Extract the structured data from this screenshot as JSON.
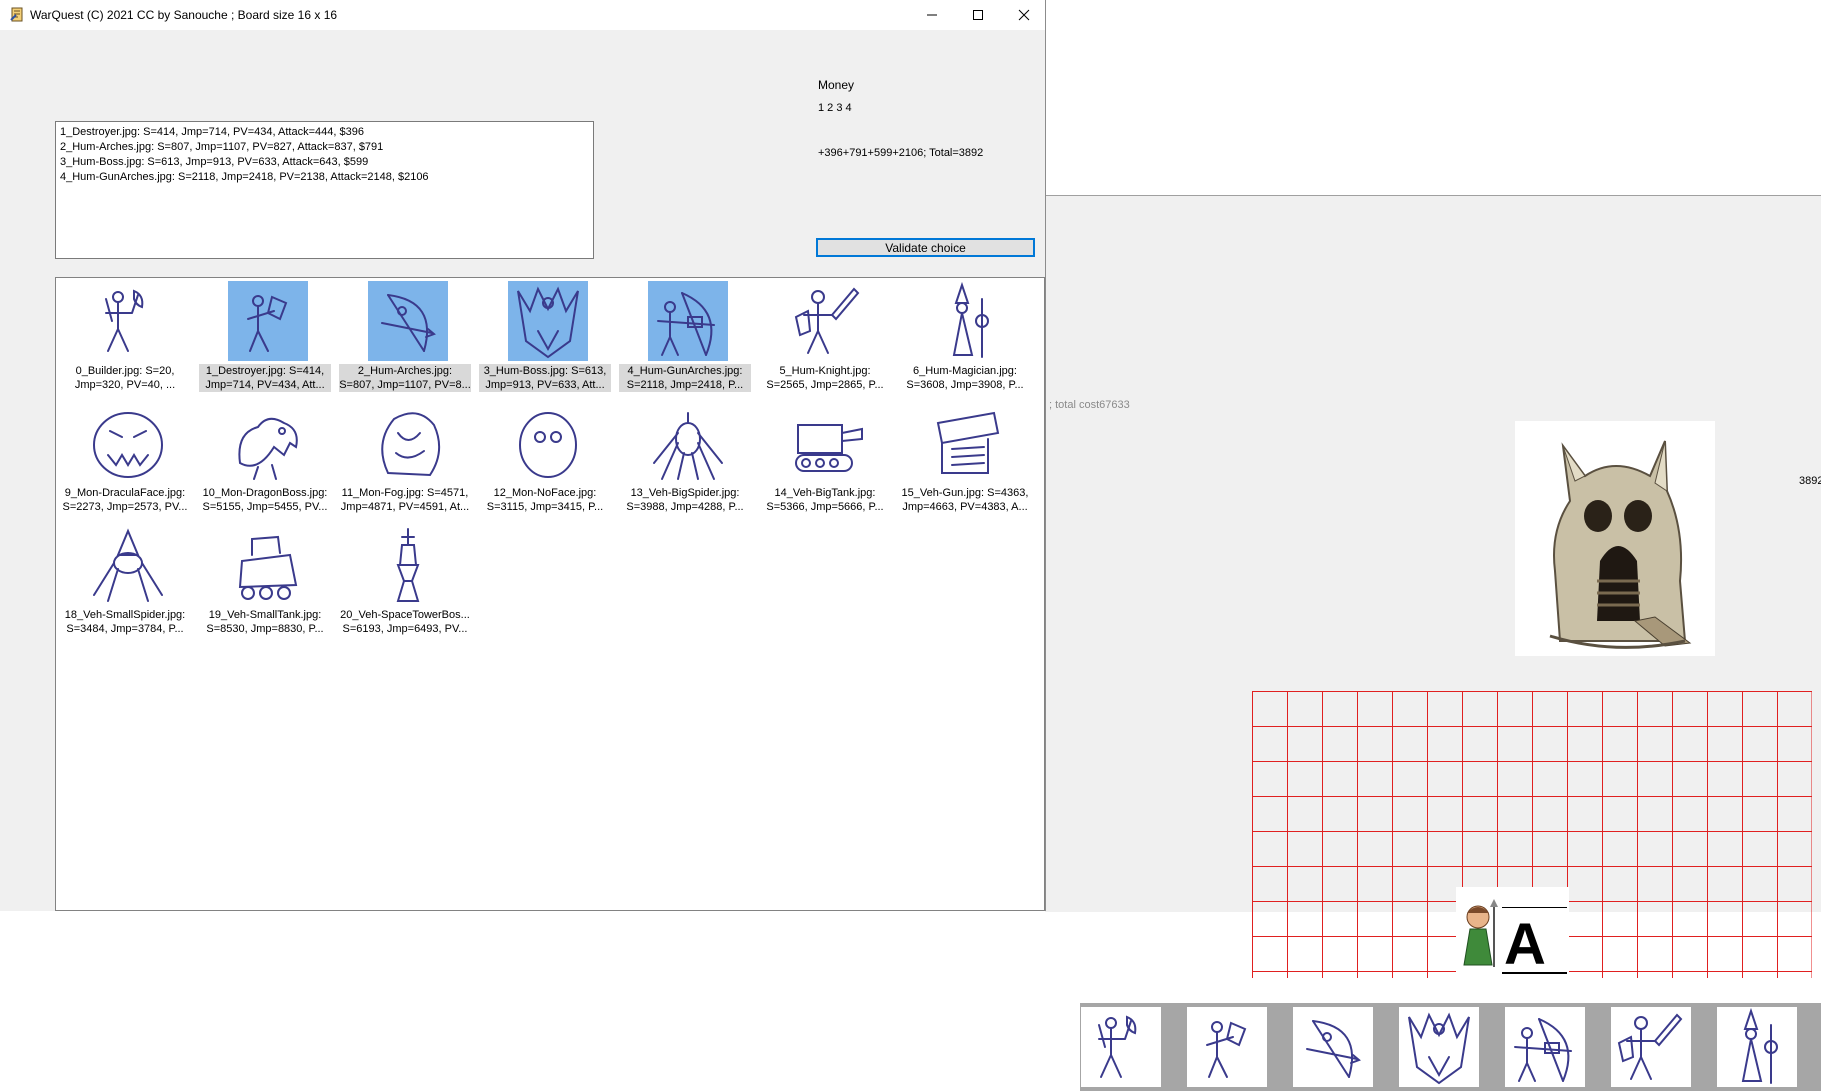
{
  "main_window": {
    "title": "WarQuest (C) 2021 CC by Sanouche  ; Board size 16 x 16",
    "money": {
      "label": "Money",
      "selected_numbers": "1 2 3 4",
      "total_text": "+396+791+599+2106; Total=3892"
    },
    "validate_label": "Validate choice",
    "selection_lines": [
      "1_Destroyer.jpg: S=414, Jmp=714, PV=434, Attack=444, $396",
      "2_Hum-Arches.jpg: S=807, Jmp=1107, PV=827, Attack=837, $791",
      "3_Hum-Boss.jpg: S=613, Jmp=913, PV=633, Attack=643, $599",
      "4_Hum-GunArches.jpg: S=2118, Jmp=2418, PV=2138, Attack=2148, $2106"
    ],
    "units": [
      {
        "label1": "0_Builder.jpg: S=20,",
        "label2": "Jmp=320, PV=40, ...",
        "icon": "builder-sketch-icon",
        "selected": false
      },
      {
        "label1": "1_Destroyer.jpg: S=414,",
        "label2": "Jmp=714, PV=434, Att...",
        "icon": "destroyer-sketch-icon",
        "selected": true
      },
      {
        "label1": "2_Hum-Arches.jpg:",
        "label2": "S=807, Jmp=1107, PV=8...",
        "icon": "archer-sketch-icon",
        "selected": true
      },
      {
        "label1": "3_Hum-Boss.jpg: S=613,",
        "label2": "Jmp=913, PV=633, Att...",
        "icon": "boss-sketch-icon",
        "selected": true
      },
      {
        "label1": "4_Hum-GunArches.jpg:",
        "label2": "S=2118, Jmp=2418, P...",
        "icon": "gun-archer-sketch-icon",
        "selected": true
      },
      {
        "label1": "5_Hum-Knight.jpg:",
        "label2": "S=2565, Jmp=2865, P...",
        "icon": "knight-sketch-icon",
        "selected": false
      },
      {
        "label1": "6_Hum-Magician.jpg:",
        "label2": "S=3608, Jmp=3908, P...",
        "icon": "magician-sketch-icon",
        "selected": false
      },
      {
        "label1": "9_Mon-DraculaFace.jpg:",
        "label2": "S=2273, Jmp=2573, PV...",
        "icon": "dracula-face-sketch-icon",
        "selected": false
      },
      {
        "label1": "10_Mon-DragonBoss.jpg:",
        "label2": "S=5155, Jmp=5455, PV...",
        "icon": "dragon-sketch-icon",
        "selected": false
      },
      {
        "label1": "11_Mon-Fog.jpg: S=4571,",
        "label2": "Jmp=4871, PV=4591, At...",
        "icon": "fog-monster-sketch-icon",
        "selected": false
      },
      {
        "label1": "12_Mon-NoFace.jpg:",
        "label2": "S=3115, Jmp=3415, P...",
        "icon": "noface-sketch-icon",
        "selected": false
      },
      {
        "label1": "13_Veh-BigSpider.jpg:",
        "label2": "S=3988, Jmp=4288, P...",
        "icon": "big-spider-sketch-icon",
        "selected": false
      },
      {
        "label1": "14_Veh-BigTank.jpg:",
        "label2": "S=5366, Jmp=5666, P...",
        "icon": "big-tank-sketch-icon",
        "selected": false
      },
      {
        "label1": "15_Veh-Gun.jpg: S=4363,",
        "label2": "Jmp=4663, PV=4383, A...",
        "icon": "gun-vehicle-sketch-icon",
        "selected": false
      },
      {
        "label1": "18_Veh-SmallSpider.jpg:",
        "label2": "S=3484, Jmp=3784, P...",
        "icon": "small-spider-sketch-icon",
        "selected": false
      },
      {
        "label1": "19_Veh-SmallTank.jpg:",
        "label2": "S=8530, Jmp=8830, P...",
        "icon": "small-tank-sketch-icon",
        "selected": false
      },
      {
        "label1": "20_Veh-SpaceTowerBos...",
        "label2": "S=6193, Jmp=6493, PV...",
        "icon": "space-tower-sketch-icon",
        "selected": false
      }
    ]
  },
  "background_window": {
    "cost_text": "; total cost67633",
    "money_text": "3892",
    "board": {
      "cols": 16,
      "rows": 8,
      "grid_color": "#e02020"
    },
    "hero_letter": "A",
    "unit_bar_icons": [
      "builder-sketch-icon",
      "destroyer-sketch-icon",
      "archer-sketch-icon",
      "boss-sketch-icon",
      "gun-archer-sketch-icon",
      "knight-sketch-icon",
      "magician-sketch-icon"
    ]
  },
  "colors": {
    "selection_highlight": "#7db4ea",
    "button_focus_border": "#0078d7",
    "sketch_ink": "#3a3a8c"
  }
}
